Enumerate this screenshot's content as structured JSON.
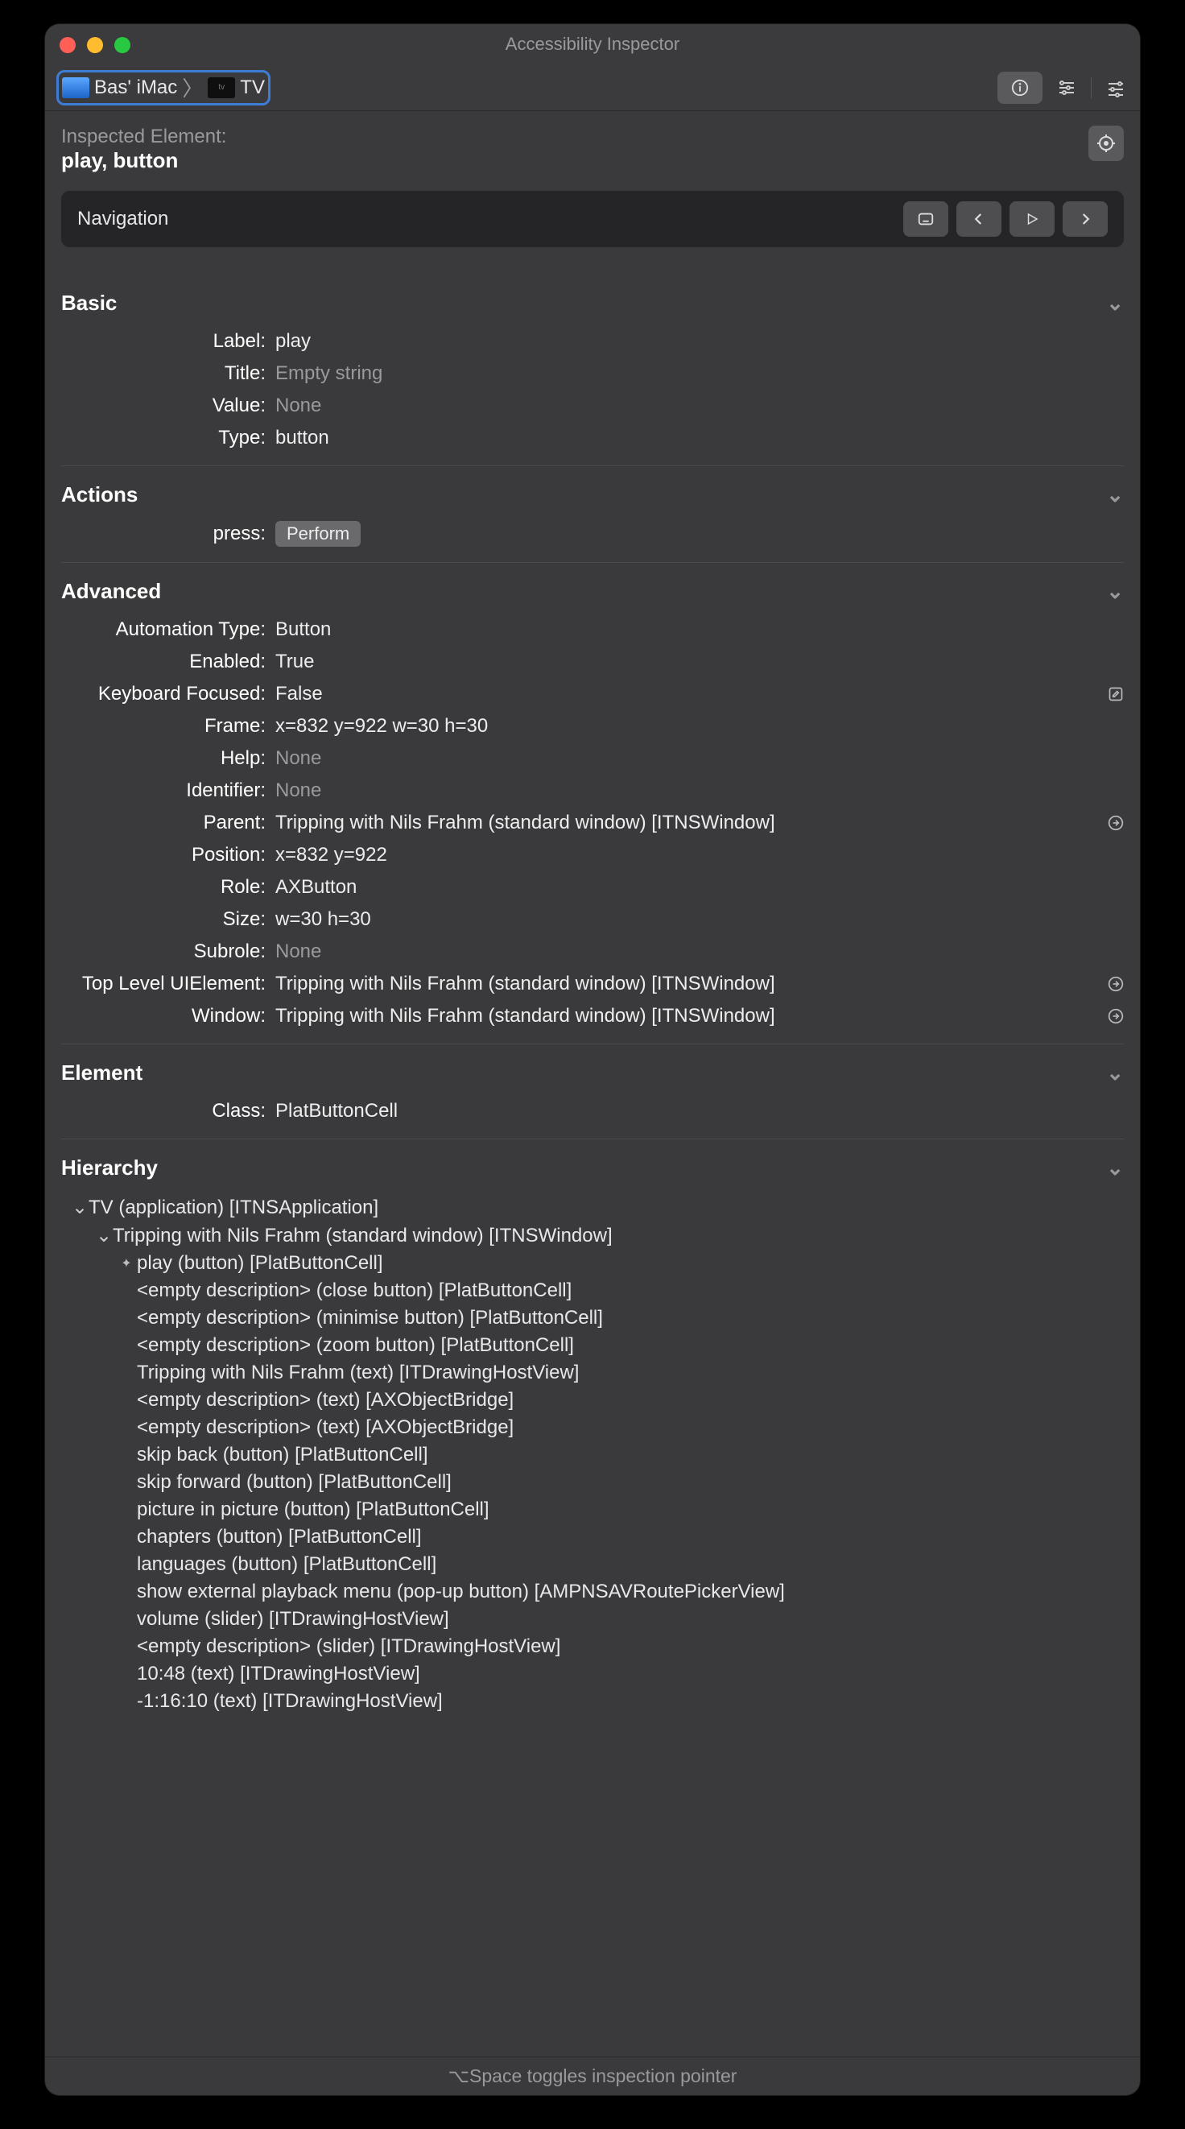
{
  "window_title": "Accessibility Inspector",
  "breadcrumb": {
    "host": "Bas' iMac",
    "app": "TV"
  },
  "inspected": {
    "heading": "Inspected Element:",
    "name": "play, button"
  },
  "nav": {
    "label": "Navigation"
  },
  "sections": {
    "basic": {
      "title": "Basic",
      "rows": [
        {
          "k": "Label:",
          "v": "play"
        },
        {
          "k": "Title:",
          "v": "Empty string",
          "dim": true
        },
        {
          "k": "Value:",
          "v": "None",
          "dim": true
        },
        {
          "k": "Type:",
          "v": "button"
        }
      ]
    },
    "actions": {
      "title": "Actions",
      "press_label": "press:",
      "perform": "Perform"
    },
    "advanced": {
      "title": "Advanced",
      "rows": [
        {
          "k": "Automation Type:",
          "v": "Button"
        },
        {
          "k": "Enabled:",
          "v": "True"
        },
        {
          "k": "Keyboard Focused:",
          "v": "False",
          "tail": "edit"
        },
        {
          "k": "Frame:",
          "v": "x=832 y=922 w=30 h=30"
        },
        {
          "k": "Help:",
          "v": "None",
          "dim": true
        },
        {
          "k": "Identifier:",
          "v": "None",
          "dim": true
        },
        {
          "k": "Parent:",
          "v": "Tripping with Nils Frahm (standard window) [ITNSWindow]",
          "tail": "go"
        },
        {
          "k": "Position:",
          "v": "x=832 y=922"
        },
        {
          "k": "Role:",
          "v": "AXButton"
        },
        {
          "k": "Size:",
          "v": "w=30 h=30"
        },
        {
          "k": "Subrole:",
          "v": "None",
          "dim": true
        },
        {
          "k": "Top Level UIElement:",
          "v": "Tripping with Nils Frahm (standard window) [ITNSWindow]",
          "tail": "go"
        },
        {
          "k": "Window:",
          "v": "Tripping with Nils Frahm (standard window) [ITNSWindow]",
          "tail": "go"
        }
      ]
    },
    "element": {
      "title": "Element",
      "rows": [
        {
          "k": "Class:",
          "v": "PlatButtonCell"
        }
      ]
    },
    "hierarchy": {
      "title": "Hierarchy",
      "rows": [
        {
          "indent": 0,
          "exp": true,
          "text": "TV (application) [ITNSApplication]"
        },
        {
          "indent": 1,
          "exp": true,
          "text": "Tripping with Nils Frahm (standard window) [ITNSWindow]"
        },
        {
          "indent": 2,
          "loc": true,
          "text": "play (button) [PlatButtonCell]"
        },
        {
          "indent": 2,
          "text": "<empty description> (close button) [PlatButtonCell]"
        },
        {
          "indent": 2,
          "text": "<empty description> (minimise button) [PlatButtonCell]"
        },
        {
          "indent": 2,
          "text": "<empty description> (zoom button) [PlatButtonCell]"
        },
        {
          "indent": 2,
          "text": "Tripping with Nils Frahm (text) [ITDrawingHostView]"
        },
        {
          "indent": 2,
          "text": "<empty description> (text) [AXObjectBridge]"
        },
        {
          "indent": 2,
          "text": "<empty description> (text) [AXObjectBridge]"
        },
        {
          "indent": 2,
          "text": "skip back (button) [PlatButtonCell]"
        },
        {
          "indent": 2,
          "text": "skip forward (button) [PlatButtonCell]"
        },
        {
          "indent": 2,
          "text": "picture in picture (button) [PlatButtonCell]"
        },
        {
          "indent": 2,
          "text": "chapters (button) [PlatButtonCell]"
        },
        {
          "indent": 2,
          "text": "languages (button) [PlatButtonCell]"
        },
        {
          "indent": 2,
          "text": "show external playback menu (pop-up button) [AMPNSAVRoutePickerView]"
        },
        {
          "indent": 2,
          "text": "volume (slider) [ITDrawingHostView]"
        },
        {
          "indent": 2,
          "text": "<empty description> (slider) [ITDrawingHostView]"
        },
        {
          "indent": 2,
          "text": "10:48 (text) [ITDrawingHostView]"
        },
        {
          "indent": 2,
          "text": "-1:16:10 (text) [ITDrawingHostView]"
        }
      ]
    }
  },
  "footer": "⌥Space toggles inspection pointer"
}
